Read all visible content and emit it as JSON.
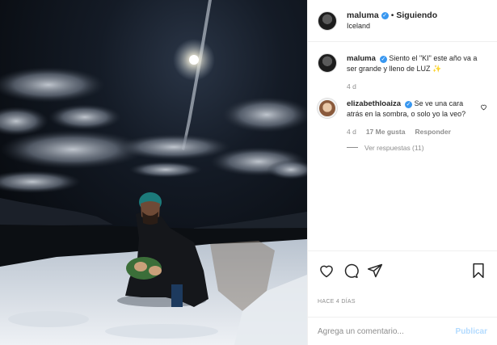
{
  "post": {
    "username": "maluma",
    "follow_status": "Siguiendo",
    "separator": "•",
    "location": "Iceland",
    "caption_username": "maluma",
    "caption": "Siento el \"KI\" este año va a ser grande y lleno de LUZ ✨",
    "caption_age": "4 d",
    "time_ago": "HACE 4 DÍAS"
  },
  "comment": {
    "username": "elizabethloaiza",
    "text": "Se ve una cara atrás en la sombra, o solo yo la veo?",
    "age": "4 d",
    "likes": "17 Me gusta",
    "reply": "Responder",
    "view_replies": "Ver respuestas (11)"
  },
  "composer": {
    "placeholder": "Agrega un comentario...",
    "publish_label": "Publicar"
  },
  "icons": {
    "like": "heart-icon",
    "comment": "comment-icon",
    "share": "share-icon",
    "save": "bookmark-icon",
    "verified": "verified-badge-icon"
  },
  "colors": {
    "verified": "#3897f0",
    "muted_text": "#8e8e8e",
    "publish_disabled": "#b3dbff"
  }
}
